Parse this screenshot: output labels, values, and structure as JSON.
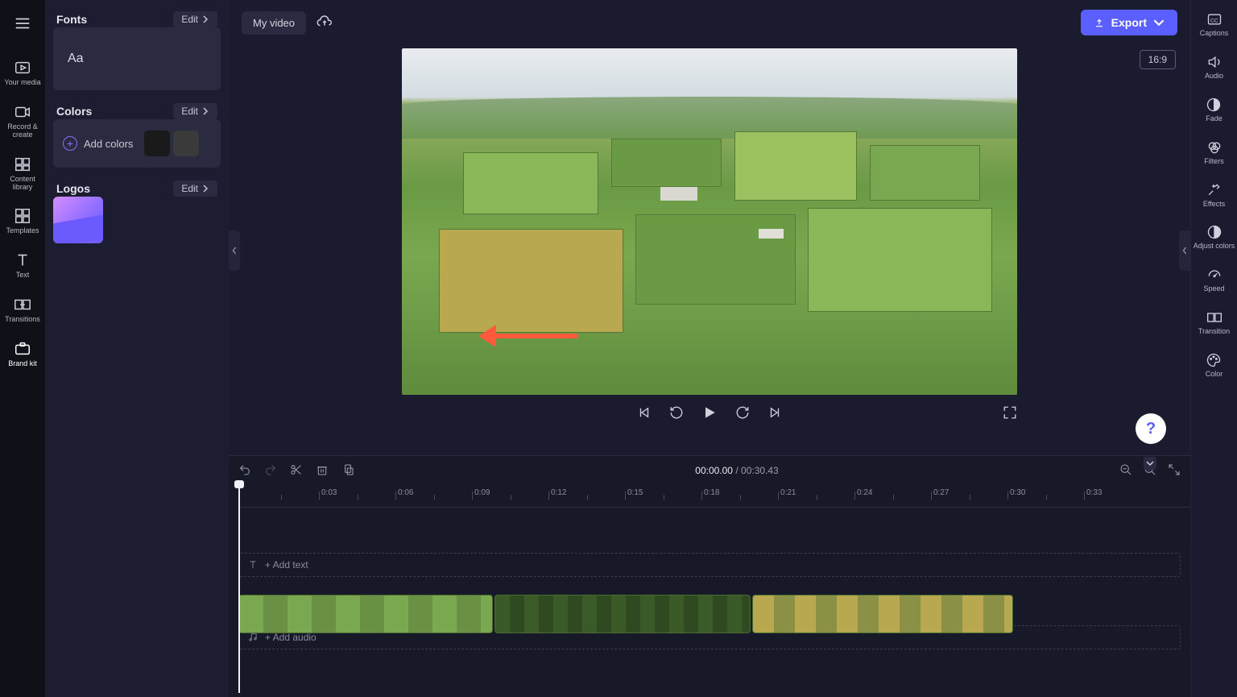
{
  "left_rail": {
    "items": [
      {
        "label": "Your media"
      },
      {
        "label": "Record & create"
      },
      {
        "label": "Content library"
      },
      {
        "label": "Templates"
      },
      {
        "label": "Text"
      },
      {
        "label": "Transitions"
      },
      {
        "label": "Brand kit"
      }
    ]
  },
  "side_panel": {
    "fonts_heading": "Fonts",
    "fonts_edit": "Edit",
    "font_sample": "Aa",
    "colors_heading": "Colors",
    "colors_edit": "Edit",
    "add_colors": "Add colors",
    "logos_heading": "Logos",
    "logos_edit": "Edit"
  },
  "top_bar": {
    "video_title": "My video",
    "export": "Export"
  },
  "preview": {
    "aspect": "16:9"
  },
  "timeline": {
    "current": "00:00.00",
    "separator": "/",
    "total": "00:30.43",
    "add_text": "+ Add text",
    "add_audio": "+ Add audio",
    "ticks": [
      "0:03",
      "0:06",
      "0:09",
      "0:12",
      "0:15",
      "0:18",
      "0:21",
      "0:24",
      "0:27",
      "0:30",
      "0:33"
    ]
  },
  "right_rail": {
    "items": [
      {
        "label": "Captions"
      },
      {
        "label": "Audio"
      },
      {
        "label": "Fade"
      },
      {
        "label": "Filters"
      },
      {
        "label": "Effects"
      },
      {
        "label": "Adjust colors"
      },
      {
        "label": "Speed"
      },
      {
        "label": "Transition"
      },
      {
        "label": "Color"
      }
    ]
  },
  "help": "?"
}
